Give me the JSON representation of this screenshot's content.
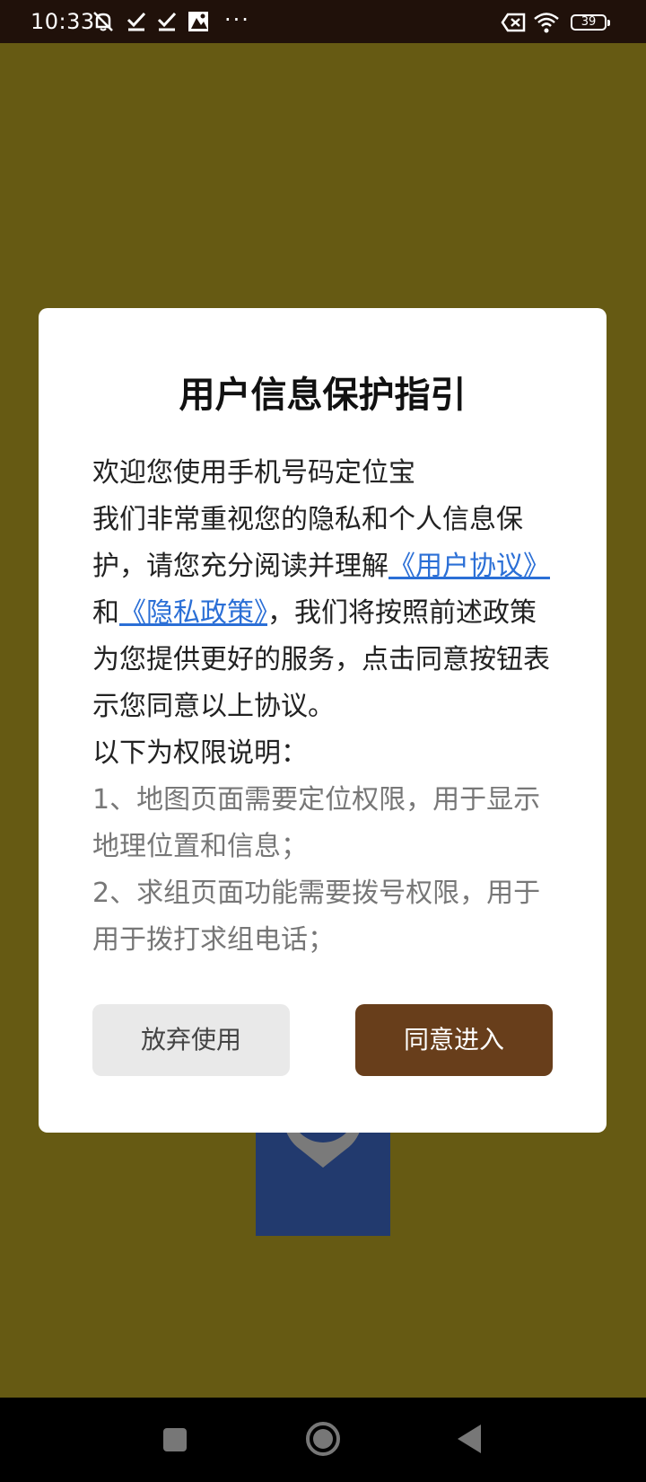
{
  "status_bar": {
    "time": "10:33",
    "dots": "···",
    "battery": "39",
    "icons": [
      "mute-icon",
      "check-icon",
      "check-icon",
      "image-icon",
      "sim-error-icon",
      "wifi-icon",
      "battery-icon"
    ]
  },
  "dialog": {
    "title": "用户信息保护指引",
    "welcome": "欢迎您使用手机号码定位宝",
    "intro_part1": "我们非常重视您的隐私和个人信息保护，请您充分阅读并理解",
    "user_agreement_link": "《用户协议》",
    "and_text": "和",
    "privacy_policy_link": "《隐私政策》",
    "intro_part2": "，我们将按照前述政策为您提供更好的服务，点击同意按钮表示您同意以上协议。",
    "permission_heading": "以下为权限说明：",
    "permission_1": "1、地图页面需要定位权限，用于显示地理位置和信息；",
    "permission_2": "2、求组页面功能需要拨号权限，用于用于拨打求组电话；",
    "decline_button": "放弃使用",
    "agree_button": "同意进入"
  },
  "colors": {
    "background": "#665a13",
    "agree_button": "#683e1b",
    "link": "#2b6fd6"
  }
}
